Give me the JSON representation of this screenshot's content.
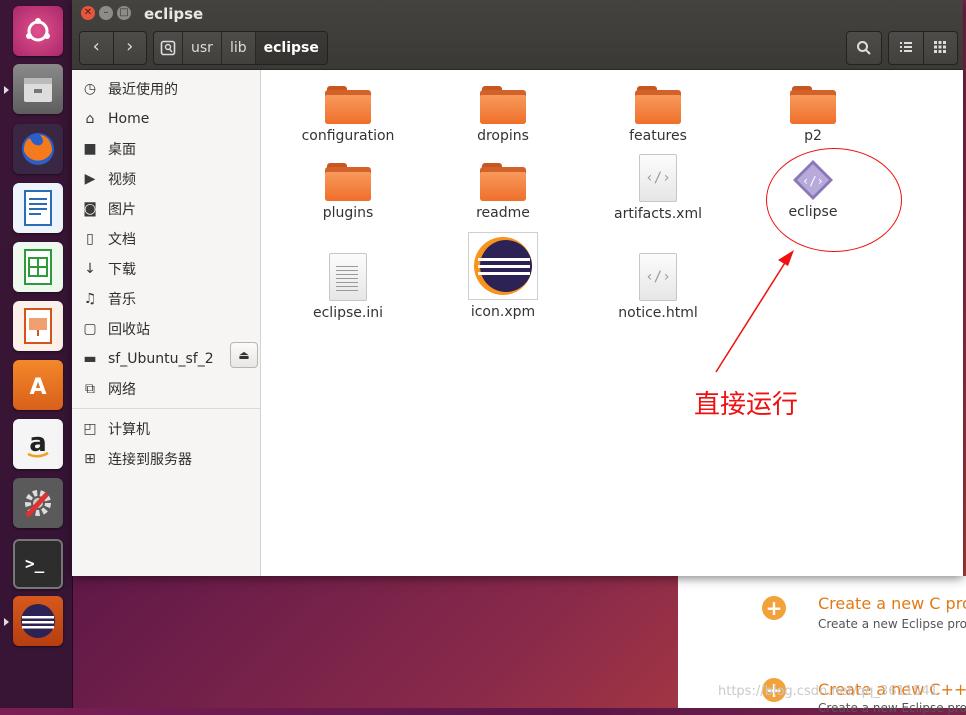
{
  "window": {
    "title": "eclipse"
  },
  "breadcrumbs": [
    "usr",
    "lib",
    "eclipse"
  ],
  "sidebar": {
    "places": [
      {
        "label": "最近使用的",
        "icon": "clock-icon"
      },
      {
        "label": "Home",
        "icon": "home-icon"
      },
      {
        "label": "桌面",
        "icon": "desktop-folder-icon"
      },
      {
        "label": "视频",
        "icon": "video-icon"
      },
      {
        "label": "图片",
        "icon": "camera-icon"
      },
      {
        "label": "文档",
        "icon": "document-icon"
      },
      {
        "label": "下载",
        "icon": "download-icon"
      },
      {
        "label": "音乐",
        "icon": "music-icon"
      },
      {
        "label": "回收站",
        "icon": "trash-icon"
      },
      {
        "label": "sf_Ubuntu_sf_2",
        "icon": "drive-icon"
      },
      {
        "label": "网络",
        "icon": "network-icon"
      }
    ],
    "devices": [
      {
        "label": "计算机",
        "icon": "computer-icon"
      },
      {
        "label": "连接到服务器",
        "icon": "server-icon"
      }
    ]
  },
  "files": [
    {
      "name": "configuration",
      "type": "folder"
    },
    {
      "name": "dropins",
      "type": "folder"
    },
    {
      "name": "features",
      "type": "folder"
    },
    {
      "name": "p2",
      "type": "folder"
    },
    {
      "name": "plugins",
      "type": "folder"
    },
    {
      "name": "readme",
      "type": "folder"
    },
    {
      "name": "artifacts.xml",
      "type": "code"
    },
    {
      "name": "eclipse",
      "type": "executable"
    },
    {
      "name": "eclipse.ini",
      "type": "text"
    },
    {
      "name": "icon.xpm",
      "type": "image"
    },
    {
      "name": "notice.html",
      "type": "code"
    }
  ],
  "annotation": {
    "text": "直接运行",
    "color": "#ee1111"
  },
  "background_panel": {
    "items": [
      {
        "title": "Create a new C pro",
        "subtitle": "Create a new Eclipse pro"
      },
      {
        "title": "Create a new C++ p",
        "subtitle": "Create a new Eclipse pro"
      }
    ]
  },
  "watermark": "https://blog.csdn.net/qq_3611541"
}
